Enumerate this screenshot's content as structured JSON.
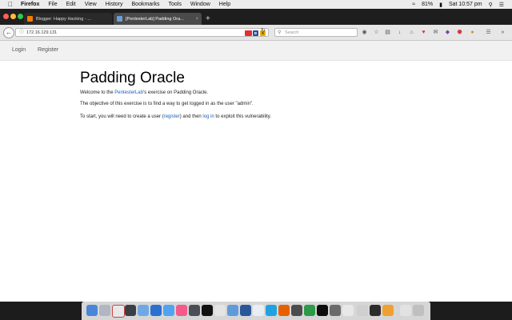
{
  "menubar": {
    "app_name": "Firefox",
    "menus": [
      "File",
      "Edit",
      "View",
      "History",
      "Bookmarks",
      "Tools",
      "Window",
      "Help"
    ],
    "battery": "81%",
    "clock": "Sat 10:57 pm"
  },
  "tabs": [
    {
      "title": "Blogger: Happy Hacking - ...",
      "favicon_color": "#f57d00"
    },
    {
      "title": "[PentesterLab] Padding Ora...",
      "favicon_color": "#6aa0d6"
    }
  ],
  "navbar": {
    "url": "172.16.129.131",
    "search_placeholder": "Search",
    "ext_badges": [
      "B",
      "X"
    ]
  },
  "site": {
    "nav": {
      "login": "Login",
      "register": "Register"
    },
    "title": "Padding Oracle",
    "welcome": {
      "prefix": "Welcome to the ",
      "link": "PentesterLab",
      "suffix": "'s exercise on Padding Oracle."
    },
    "objective": "The objective of this exercise is to find a way to get logged in as the user \"admin\".",
    "start": {
      "prefix": "To start, you will need to create a user (",
      "register_link": "register",
      "middle": ") and then ",
      "login_link": "log in",
      "suffix": " to exploit this vulnerability."
    }
  },
  "colors": {
    "link": "#1a5fb4",
    "close": "#fc605b",
    "minimize": "#fdbc40",
    "zoom": "#34c84a"
  }
}
